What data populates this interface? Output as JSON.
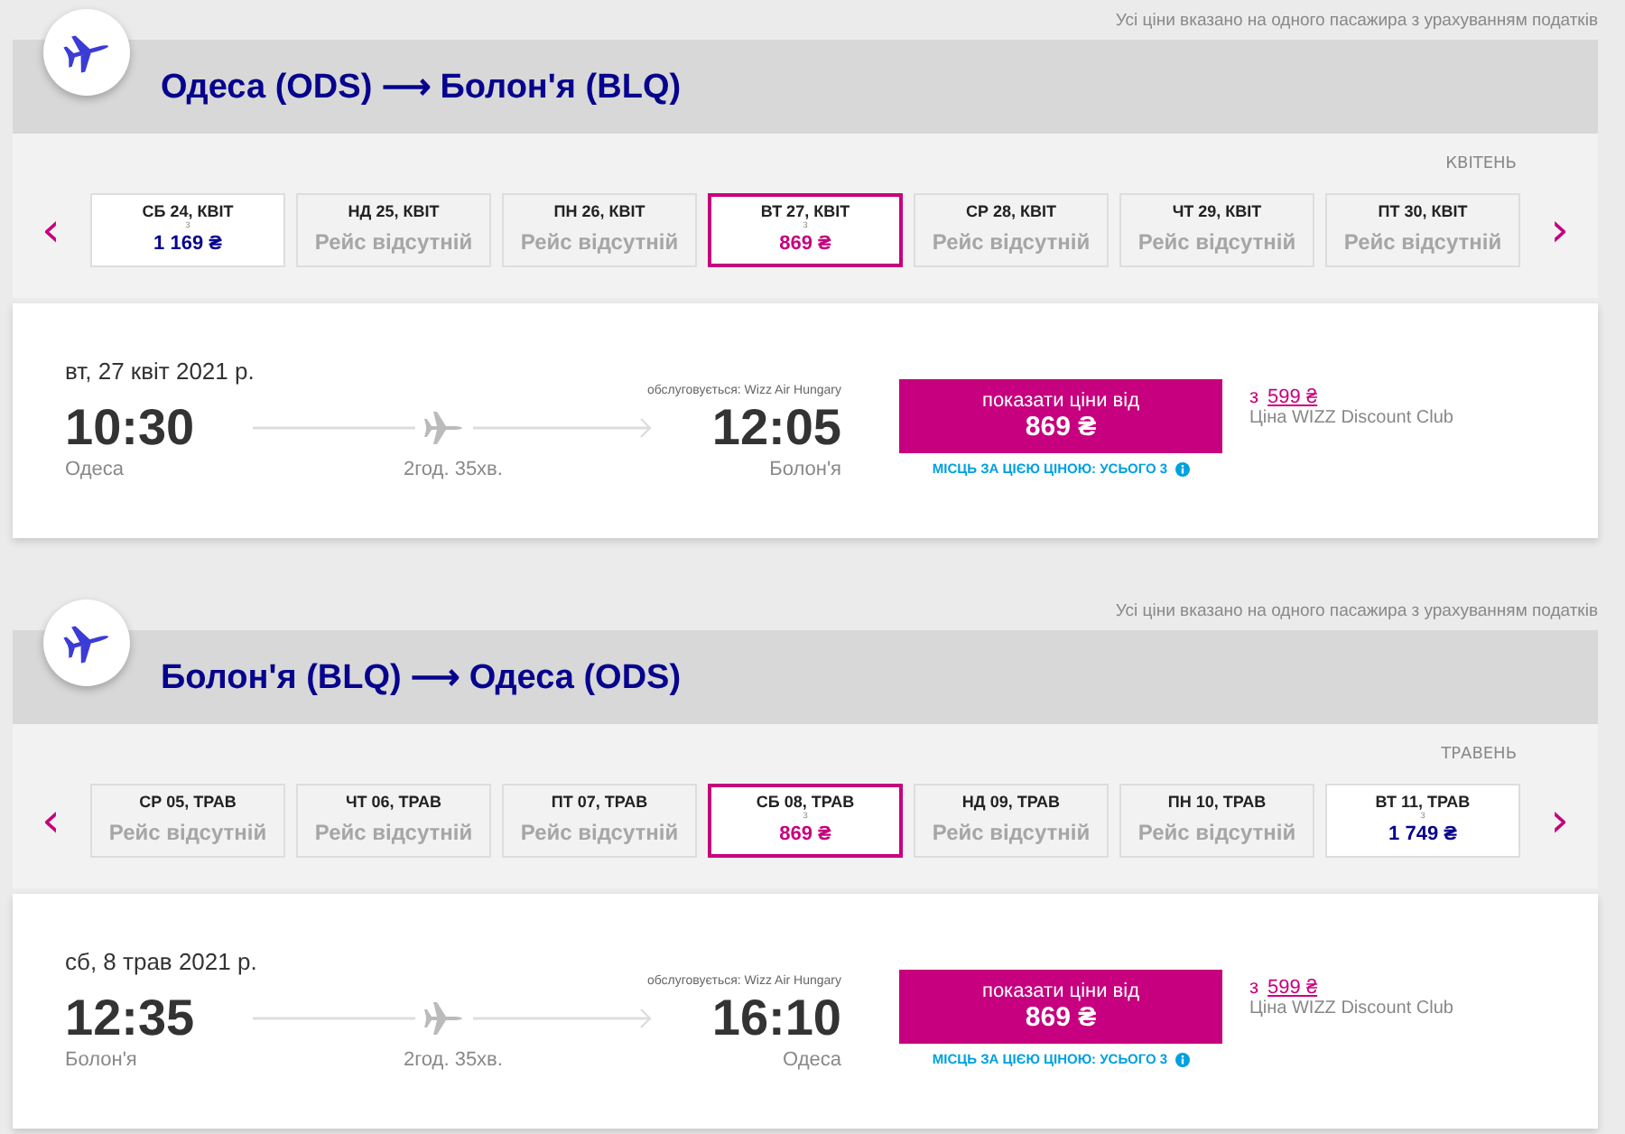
{
  "sections": [
    {
      "note": "Усі ціни вказано на одного пасажира з урахуванням податків",
      "route": "Одеса (ODS) ⟶ Болон'я (BLQ)",
      "month": "КВІТЕНЬ",
      "prev": "‹",
      "next": "›",
      "dates": [
        {
          "day": "СБ 24, КВІТ",
          "kind": "fare",
          "from": "з",
          "price": "1 169 ₴",
          "selected": false
        },
        {
          "day": "НД 25, КВІТ",
          "kind": "none",
          "status": "Рейс відсутній",
          "selected": false
        },
        {
          "day": "ПН 26, КВІТ",
          "kind": "none",
          "status": "Рейс відсутній",
          "selected": false
        },
        {
          "day": "ВТ 27, КВІТ",
          "kind": "fare",
          "from": "з",
          "price": "869 ₴",
          "selected": true
        },
        {
          "day": "СР 28, КВІТ",
          "kind": "none",
          "status": "Рейс відсутній",
          "selected": false
        },
        {
          "day": "ЧТ 29, КВІТ",
          "kind": "none",
          "status": "Рейс відсутній",
          "selected": false
        },
        {
          "day": "ПТ 30, КВІТ",
          "kind": "none",
          "status": "Рейс відсутній",
          "selected": false
        }
      ],
      "flight": {
        "date": "вт, 27 квіт 2021 р.",
        "operator": "обслуговується: Wizz Air Hungary",
        "depart": "10:30",
        "arrive": "12:05",
        "from_city": "Одеса",
        "to_city": "Болон'я",
        "duration": "2год. 35хв.",
        "button_label": "показати ціни від",
        "button_price": "869 ₴",
        "seats": "МІСЦЬ ЗА ЦІЄЮ ЦІНОЮ: УСЬОГО 3",
        "club_from": "з",
        "club_price": "599 ₴",
        "club_label": "Ціна WIZZ Discount Club"
      }
    },
    {
      "note": "Усі ціни вказано на одного пасажира з урахуванням податків",
      "route": "Болон'я (BLQ) ⟶ Одеса (ODS)",
      "month": "ТРАВЕНЬ",
      "prev": "‹",
      "next": "›",
      "dates": [
        {
          "day": "СР 05, ТРАВ",
          "kind": "none",
          "status": "Рейс відсутній",
          "selected": false
        },
        {
          "day": "ЧТ 06, ТРАВ",
          "kind": "none",
          "status": "Рейс відсутній",
          "selected": false
        },
        {
          "day": "ПТ 07, ТРАВ",
          "kind": "none",
          "status": "Рейс відсутній",
          "selected": false
        },
        {
          "day": "СБ 08, ТРАВ",
          "kind": "fare",
          "from": "з",
          "price": "869 ₴",
          "selected": true
        },
        {
          "day": "НД 09, ТРАВ",
          "kind": "none",
          "status": "Рейс відсутній",
          "selected": false
        },
        {
          "day": "ПН 10, ТРАВ",
          "kind": "none",
          "status": "Рейс відсутній",
          "selected": false
        },
        {
          "day": "ВТ 11, ТРАВ",
          "kind": "fare",
          "from": "з",
          "price": "1 749 ₴",
          "selected": false
        }
      ],
      "flight": {
        "date": "сб, 8 трав 2021 р.",
        "operator": "обслуговується: Wizz Air Hungary",
        "depart": "12:35",
        "arrive": "16:10",
        "from_city": "Болон'я",
        "to_city": "Одеса",
        "duration": "2год. 35хв.",
        "button_label": "показати ціни від",
        "button_price": "869 ₴",
        "seats": "МІСЦЬ ЗА ЦІЄЮ ЦІНОЮ: УСЬОГО 3",
        "club_from": "з",
        "club_price": "599 ₴",
        "club_label": "Ціна WIZZ Discount Club"
      }
    }
  ]
}
